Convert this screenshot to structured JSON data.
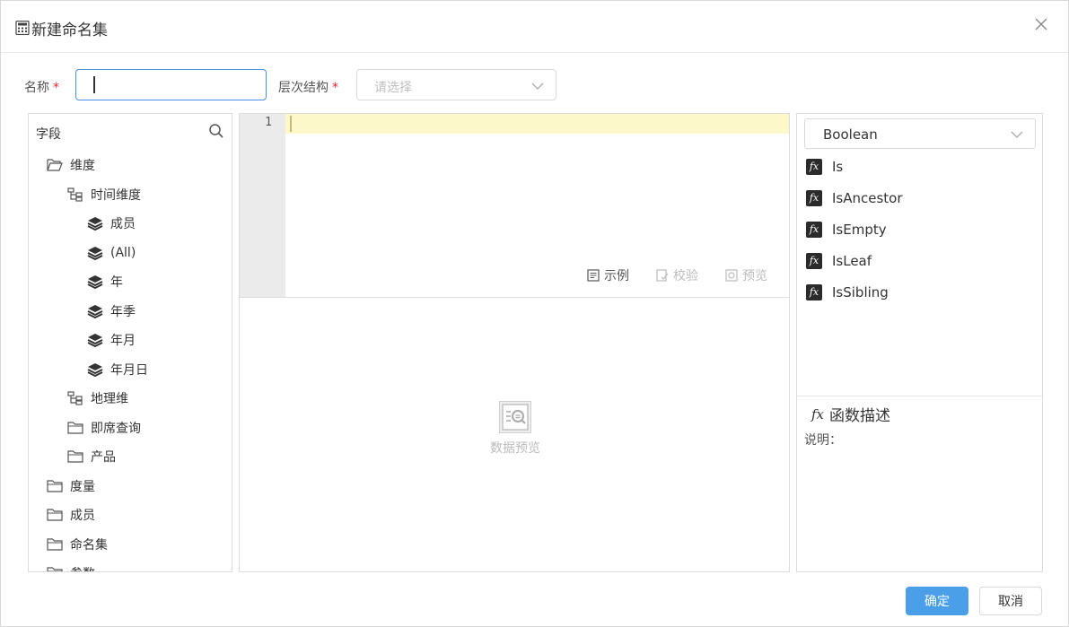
{
  "dialog": {
    "title": "新建命名集",
    "icon": "calculator-icon"
  },
  "form": {
    "name_label": "名称",
    "name_required": "*",
    "name_value": "",
    "hierarchy_label": "层次结构",
    "hierarchy_required": "*",
    "hierarchy_placeholder": "请选择"
  },
  "fields_panel": {
    "title": "字段",
    "tree": [
      {
        "label": "维度",
        "icon": "folder-open-icon",
        "level": 0
      },
      {
        "label": "时间维度",
        "icon": "hierarchy-icon",
        "level": 1
      },
      {
        "label": "成员",
        "icon": "layers-icon",
        "level": 2
      },
      {
        "label": "(All)",
        "icon": "layers-icon",
        "level": 2
      },
      {
        "label": "年",
        "icon": "layers-icon",
        "level": 2
      },
      {
        "label": "年季",
        "icon": "layers-icon",
        "level": 2
      },
      {
        "label": "年月",
        "icon": "layers-icon",
        "level": 2
      },
      {
        "label": "年月日",
        "icon": "layers-icon",
        "level": 2
      },
      {
        "label": "地理维",
        "icon": "hierarchy-icon",
        "level": 1
      },
      {
        "label": "即席查询",
        "icon": "folder-icon",
        "level": 1
      },
      {
        "label": "产品",
        "icon": "folder-icon",
        "level": 1
      },
      {
        "label": "度量",
        "icon": "folder-icon",
        "level": 0
      },
      {
        "label": "成员",
        "icon": "folder-icon",
        "level": 0
      },
      {
        "label": "命名集",
        "icon": "folder-icon",
        "level": 0
      },
      {
        "label": "参数",
        "icon": "folder-icon",
        "level": 0
      }
    ]
  },
  "editor": {
    "line_numbers": [
      "1"
    ],
    "tools": {
      "example": "示例",
      "validate": "校验",
      "preview": "预览"
    },
    "preview_empty_label": "数据预览"
  },
  "functions_panel": {
    "category": "Boolean",
    "functions": [
      "Is",
      "IsAncestor",
      "IsEmpty",
      "IsLeaf",
      "IsSibling"
    ],
    "fx_glyph": "fx",
    "desc_title": "函数描述",
    "desc_label": "说明："
  },
  "footer": {
    "confirm": "确定",
    "cancel": "取消"
  },
  "colors": {
    "primary": "#4a9fe8",
    "focus_border": "#4a90e2",
    "active_line": "#fdf8c9",
    "required": "#f5222d"
  }
}
